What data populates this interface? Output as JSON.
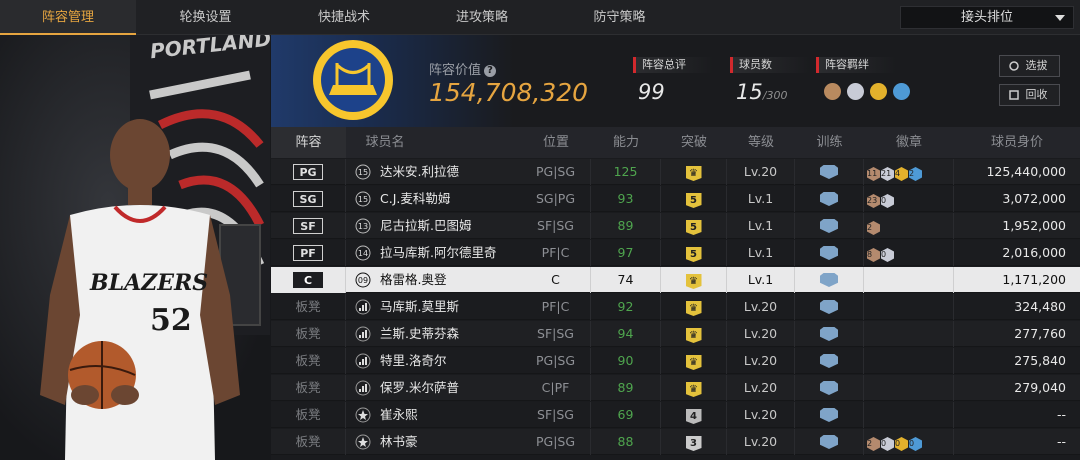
{
  "tabs": [
    {
      "label": "阵容管理",
      "active": true
    },
    {
      "label": "轮换设置",
      "active": false
    },
    {
      "label": "快捷战术",
      "active": false
    },
    {
      "label": "进攻策略",
      "active": false
    },
    {
      "label": "防守策略",
      "active": false
    }
  ],
  "sort_select": {
    "value": "接头排位"
  },
  "team": {
    "value_label": "阵容价值",
    "value": "154,708,320",
    "overall_label": "阵容总评",
    "overall": "99",
    "count_label": "球员数",
    "count": "15",
    "count_max": "/300",
    "chem_label": "阵容羁绊",
    "scout_button": "选拔",
    "recycle_button": "回收"
  },
  "columns": [
    "阵容",
    "球员名",
    "位置",
    "能力",
    "突破",
    "等级",
    "训练",
    "徽章",
    "球员身价"
  ],
  "players": [
    {
      "slot": "PG",
      "num": "15",
      "name": "达米安.利拉德",
      "pos": "PG|SG",
      "ability": "125",
      "break": "",
      "level": "Lv.20",
      "badges": [
        "11",
        "21",
        "4",
        "2"
      ],
      "price": "125,440,000"
    },
    {
      "slot": "SG",
      "num": "15",
      "name": "C.J.麦科勒姆",
      "pos": "SG|PG",
      "ability": "93",
      "break": "5",
      "level": "Lv.1",
      "badges": [
        "23",
        "0"
      ],
      "price": "3,072,000"
    },
    {
      "slot": "SF",
      "num": "13",
      "name": "尼古拉斯.巴图姆",
      "pos": "SF|SG",
      "ability": "89",
      "break": "5",
      "level": "Lv.1",
      "badges": [
        "2"
      ],
      "price": "1,952,000"
    },
    {
      "slot": "PF",
      "num": "14",
      "name": "拉马库斯.阿尔德里奇",
      "pos": "PF|C",
      "ability": "97",
      "break": "5",
      "level": "Lv.1",
      "badges": [
        "8",
        "0"
      ],
      "price": "2,016,000"
    },
    {
      "slot": "C",
      "num": "09",
      "name": "格雷格.奥登",
      "pos": "C",
      "ability": "74",
      "break": "",
      "level": "Lv.1",
      "badges": [],
      "price": "1,171,200"
    },
    {
      "slot": "板凳",
      "num": "",
      "name": "马库斯.莫里斯",
      "pos": "PF|C",
      "ability": "92",
      "break": "",
      "level": "Lv.20",
      "badges": [],
      "price": "324,480"
    },
    {
      "slot": "板凳",
      "num": "",
      "name": "兰斯.史蒂芬森",
      "pos": "SF|SG",
      "ability": "94",
      "break": "",
      "level": "Lv.20",
      "badges": [],
      "price": "277,760"
    },
    {
      "slot": "板凳",
      "num": "",
      "name": "特里.洛奇尔",
      "pos": "PG|SG",
      "ability": "90",
      "break": "",
      "level": "Lv.20",
      "badges": [],
      "price": "275,840"
    },
    {
      "slot": "板凳",
      "num": "",
      "name": "保罗.米尔萨普",
      "pos": "C|PF",
      "ability": "89",
      "break": "",
      "level": "Lv.20",
      "badges": [],
      "price": "279,040"
    },
    {
      "slot": "板凳",
      "num": "",
      "name": "崔永熙",
      "pos": "SF|SG",
      "ability": "69",
      "break": "4",
      "level": "Lv.20",
      "badges": [],
      "price": "--"
    },
    {
      "slot": "板凳",
      "num": "",
      "name": "林书豪",
      "pos": "PG|SG",
      "ability": "88",
      "break": "3",
      "level": "Lv.20",
      "badges": [
        "2",
        "0",
        "0",
        "0"
      ],
      "price": "--"
    }
  ],
  "jersey": {
    "team": "BLAZERS",
    "number": "52"
  },
  "logo_text": {
    "team": "PORTLAND"
  },
  "colors": {
    "accent": "#e6a540",
    "ability_green": "#4fa54e",
    "stat_red": "#d2292d"
  }
}
